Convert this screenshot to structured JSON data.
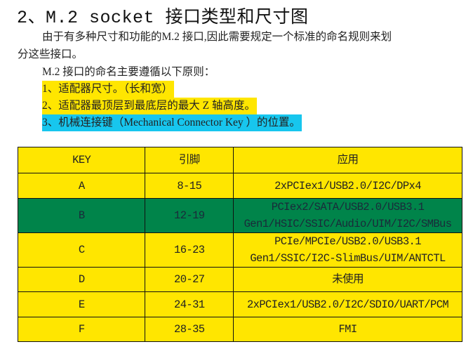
{
  "title": "2、M.2 socket 接口类型和尺寸图",
  "paragraph1_line1": "由于有多种尺寸和功能的M.2 接口,因此需要规定一个标准的命名规则来划",
  "paragraph1_line2": "分这些接口。",
  "paragraph2": "M.2 接口的命名主要遵循以下原则：",
  "rules": [
    "1、适配器尺寸。（长和宽）",
    "2、适配器最顶层到最底层的最大 Z 轴高度。",
    "3、机械连接键（Mechanical Connector Key ）的位置。"
  ],
  "colors": {
    "yellow": "#FFE600",
    "blue": "#17C6EE",
    "green": "#00844A"
  },
  "table": {
    "headers": [
      "KEY",
      "引脚",
      "应用"
    ],
    "rows": [
      {
        "key": "A",
        "pins": "8-15",
        "app": [
          "2xPCIex1/USB2.0/I2C/DPx4"
        ]
      },
      {
        "key": "B",
        "pins": "12-19",
        "app": [
          "PCIex2/SATA/USB2.0/USB3.1",
          "Gen1/HSIC/SSIC/Audio/UIM/I2C/SMBus"
        ]
      },
      {
        "key": "C",
        "pins": "16-23",
        "app": [
          "PCIe/MPCIe/USB2.0/USB3.1",
          "Gen1/SSIC/I2C-SlimBus/UIM/ANTCTL"
        ]
      },
      {
        "key": "D",
        "pins": "20-27",
        "app": [
          "未使用"
        ]
      },
      {
        "key": "E",
        "pins": "24-31",
        "app": [
          "2xPCIex1/USB2.0/I2C/SDIO/UART/PCM"
        ]
      },
      {
        "key": "F",
        "pins": "28-35",
        "app": [
          "FMI"
        ]
      }
    ]
  }
}
